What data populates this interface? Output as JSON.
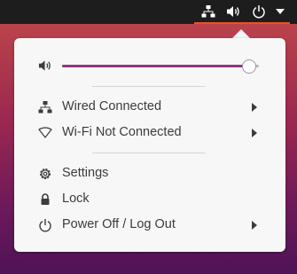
{
  "top_panel": {
    "indicators": [
      {
        "icon": "network-wired-icon"
      },
      {
        "icon": "speaker-volume-icon"
      },
      {
        "icon": "power-icon"
      },
      {
        "icon": "chevron-down-icon"
      }
    ],
    "accent_color": "#e95420"
  },
  "menu": {
    "volume": {
      "icon": "speaker-volume-icon",
      "level": 0.95,
      "fill_color": "#8c3a7d"
    },
    "network_items": [
      {
        "icon": "network-wired-icon",
        "label": "Wired Connected",
        "has_submenu": true
      },
      {
        "icon": "wifi-icon",
        "label": "Wi-Fi Not Connected",
        "has_submenu": true
      }
    ],
    "system_items": [
      {
        "icon": "gear-icon",
        "label": "Settings",
        "has_submenu": false
      },
      {
        "icon": "lock-icon",
        "label": "Lock",
        "has_submenu": false
      },
      {
        "icon": "power-icon",
        "label": "Power Off / Log Out",
        "has_submenu": true
      }
    ]
  }
}
